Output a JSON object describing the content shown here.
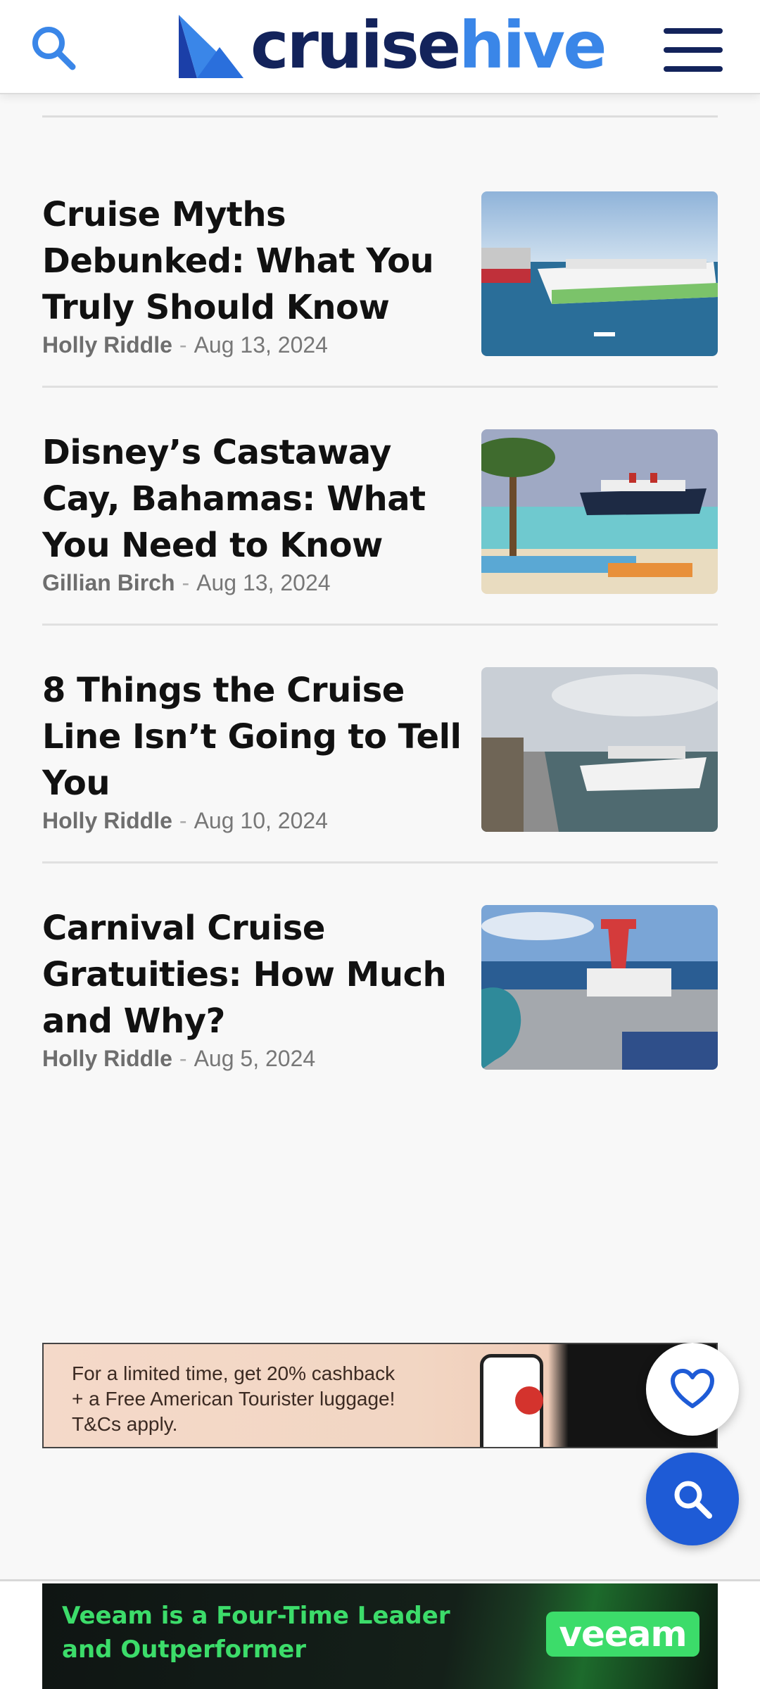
{
  "header": {
    "logo_part1": "cruise",
    "logo_part2": "hive"
  },
  "articles": [
    {
      "title": "Cruise Myths Debunked: What You Truly Should Know",
      "author": "Holly Riddle",
      "separator": "-",
      "date": "Aug 13, 2024"
    },
    {
      "title": "Disney’s Castaway Cay, Bahamas: What You Need to Know",
      "author": "Gillian Birch",
      "separator": "-",
      "date": "Aug 13, 2024"
    },
    {
      "title": "8 Things the Cruise Line Isn’t Going to Tell You",
      "author": "Holly Riddle",
      "separator": "-",
      "date": "Aug 10, 2024"
    },
    {
      "title": "Carnival Cruise Gratuities: How Much and Why?",
      "author": "Holly Riddle",
      "separator": "-",
      "date": "Aug 5, 2024"
    }
  ],
  "ad_luggage": {
    "text": "For a limited time, get 20% cashback + a Free American Tourister luggage! T&Cs apply."
  },
  "ad_veeam": {
    "text": "Veeam is a Four-Time Leader and Outperformer",
    "logo": "veeam"
  },
  "colors": {
    "brand_dark": "#13235b",
    "brand_light": "#3a86e8",
    "fab_blue": "#1e5bd6"
  },
  "icons": {
    "header_search": "search-icon",
    "menu": "hamburger-menu-icon",
    "favorite": "heart-icon",
    "fab_search": "search-icon"
  }
}
